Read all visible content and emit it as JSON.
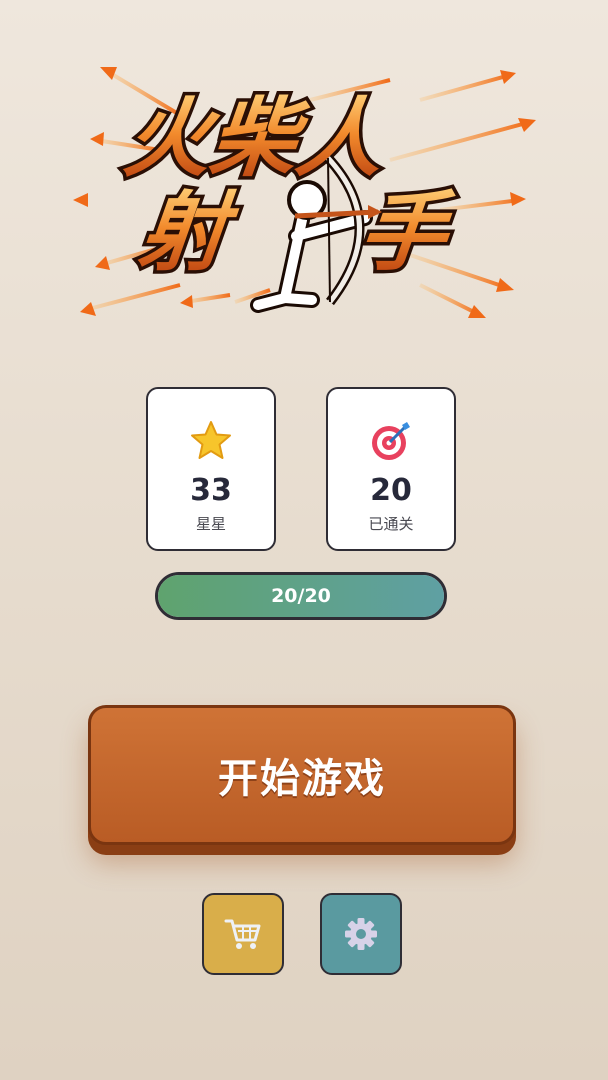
{
  "logo": {
    "line1": "火柴人",
    "line2_a": "射",
    "line2_b": "手"
  },
  "stats": {
    "stars": {
      "icon": "star-icon",
      "value": "33",
      "label": "星星"
    },
    "levels": {
      "icon": "target-icon",
      "value": "20",
      "label": "已通关"
    }
  },
  "progress": {
    "text": "20/20",
    "fraction": 1.0
  },
  "start_button": {
    "label": "开始游戏"
  },
  "buttons": {
    "shop_icon": "shopping-cart-icon",
    "settings_icon": "gear-icon"
  },
  "colors": {
    "start_button": "#c4672d",
    "shop_button": "#d9ae4a",
    "settings_button": "#5a9aa0",
    "progress_start": "#5fa36e",
    "progress_end": "#5fa0a3"
  }
}
